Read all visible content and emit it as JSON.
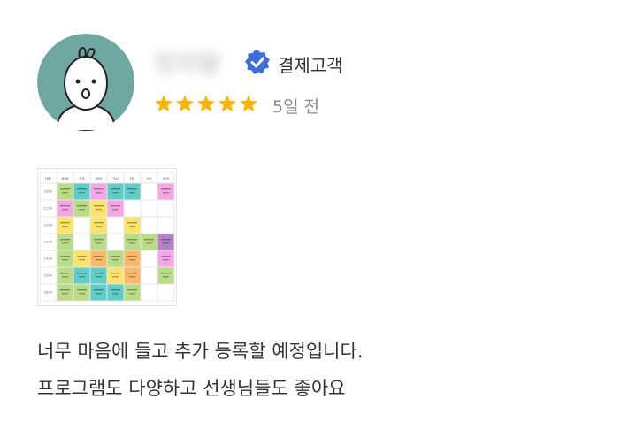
{
  "reviewer": {
    "name": "민지맘",
    "avatar_icon": "cartoon-face-avatar-icon",
    "badge_icon": "verified-badge-icon",
    "badge_label": "결제고객"
  },
  "rating": {
    "stars": 5,
    "max": 5,
    "star_color": "#f7b500"
  },
  "review": {
    "date": "5일 전",
    "lines": [
      "너무 마음에 들고 추가 등록할 예정입니다.",
      "프로그램도 다양하고 선생님들도 좋아요"
    ],
    "attachment": {
      "type": "timetable-image",
      "columns": [
        "TIME",
        "MON",
        "TUE",
        "WED",
        "THU",
        "FRI",
        "SAT",
        "SUN"
      ],
      "rows": [
        "10:00",
        "11:00",
        "12:00",
        "13:00",
        "14:00",
        "15:00",
        "16:00"
      ]
    }
  },
  "colors": {
    "avatar_bg": "#6fa8a1",
    "badge": "#3d6fd9"
  }
}
